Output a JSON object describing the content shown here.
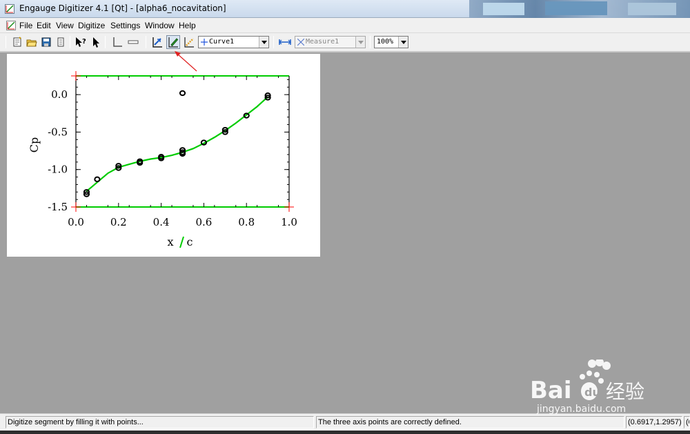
{
  "window": {
    "title": "Engauge Digitizer 4.1 [Qt] - [alpha6_nocavitation]"
  },
  "menu": {
    "items": [
      {
        "label": "File"
      },
      {
        "label": "Edit"
      },
      {
        "label": "View"
      },
      {
        "label": "Digitize"
      },
      {
        "label": "Settings"
      },
      {
        "label": "Window"
      },
      {
        "label": "Help"
      }
    ]
  },
  "toolbar": {
    "curve_select": "Curve1",
    "measure_select": "Measure1",
    "zoom_select": "100%",
    "icons": [
      "new-document-icon",
      "open-folder-icon",
      "save-disk-icon",
      "print-icon",
      "whats-this-icon",
      "select-pointer-icon",
      "axis-point-icon",
      "scale-bar-icon",
      "point-match-icon",
      "segment-fill-pencil-icon",
      "curve-point-icon",
      "measure-icon"
    ]
  },
  "plot_image": {
    "xlabel_x": "x",
    "xlabel_c": "c",
    "ylabel": "Cp",
    "x_ticks": [
      "0.0",
      "0.2",
      "0.4",
      "0.6",
      "0.8",
      "1.0"
    ],
    "y_ticks": [
      "0.0",
      "-0.5",
      "-1.0",
      "-1.5"
    ],
    "accent_green": "#00cc00",
    "axis_point_red": "#ff0000"
  },
  "chart_data": {
    "type": "scatter",
    "title": "",
    "xlabel": "x / c",
    "ylabel": "Cp",
    "xlim": [
      0.0,
      1.0
    ],
    "ylim": [
      -1.5,
      0.25
    ],
    "x_ticks": [
      0.0,
      0.2,
      0.4,
      0.6,
      0.8,
      1.0
    ],
    "y_ticks": [
      0.0,
      -0.5,
      -1.0,
      -1.5
    ],
    "series": [
      {
        "points": [
          [
            0.05,
            -1.33
          ],
          [
            0.05,
            -1.3
          ],
          [
            0.1,
            -1.13
          ],
          [
            0.2,
            -0.98
          ],
          [
            0.2,
            -0.95
          ],
          [
            0.3,
            -0.91
          ],
          [
            0.3,
            -0.89
          ],
          [
            0.4,
            -0.85
          ],
          [
            0.4,
            -0.83
          ],
          [
            0.5,
            -0.79
          ],
          [
            0.5,
            -0.77
          ],
          [
            0.5,
            -0.74
          ],
          [
            0.6,
            -0.64
          ],
          [
            0.7,
            -0.5
          ],
          [
            0.7,
            -0.47
          ],
          [
            0.8,
            -0.28
          ],
          [
            0.9,
            -0.04
          ],
          [
            0.9,
            -0.01
          ],
          [
            0.5,
            0.02
          ]
        ]
      }
    ],
    "digitized_curve": {
      "x": [
        0.05,
        0.1,
        0.15,
        0.2,
        0.25,
        0.3,
        0.35,
        0.4,
        0.45,
        0.5,
        0.55,
        0.6,
        0.65,
        0.7,
        0.75,
        0.8,
        0.85,
        0.9
      ],
      "y": [
        -1.29,
        -1.17,
        -1.05,
        -0.97,
        -0.93,
        -0.89,
        -0.86,
        -0.84,
        -0.81,
        -0.77,
        -0.72,
        -0.65,
        -0.57,
        -0.48,
        -0.38,
        -0.27,
        -0.16,
        -0.03
      ]
    }
  },
  "status": {
    "message_left": "Digitize segment by filling it with points...",
    "message_mid": "The three axis points are correctly defined.",
    "coords": "(0.6917,1.2957)",
    "extra": "(0"
  },
  "watermark": {
    "brand": "Bai",
    "brand2": "du",
    "cn": "经验",
    "url": "jingyan.baidu.com",
    "color": "#ffffff"
  }
}
